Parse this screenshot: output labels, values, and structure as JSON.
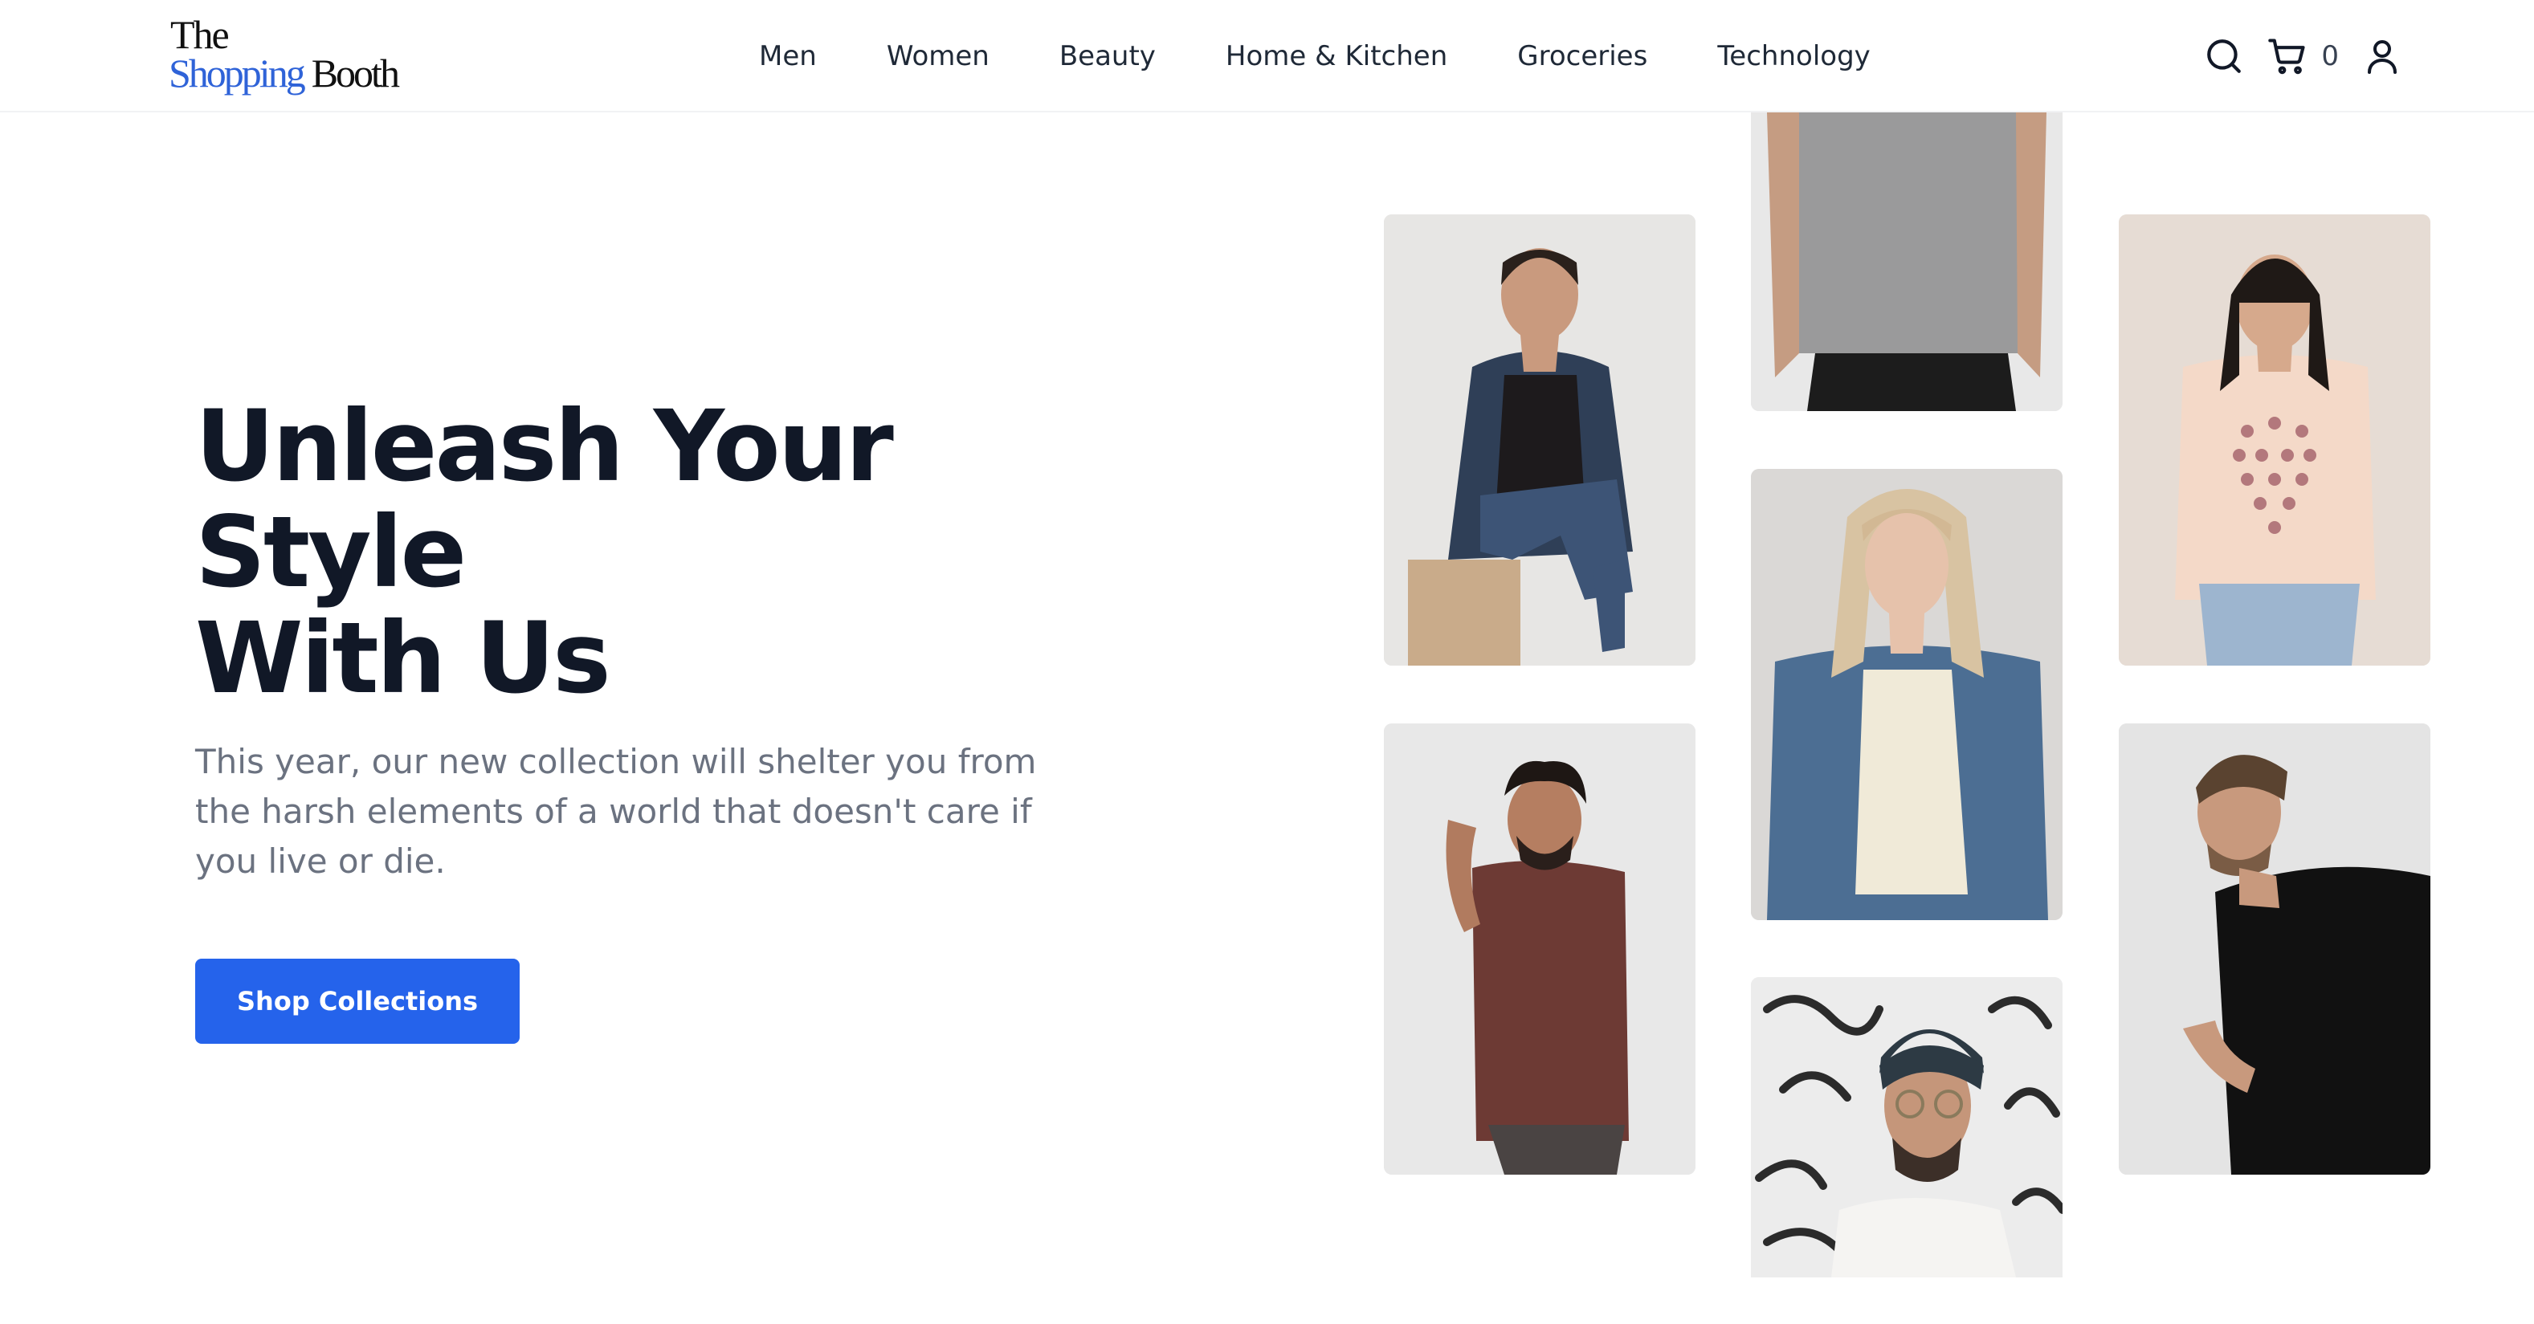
{
  "brand": {
    "line1": "The",
    "line2a": "Shopping",
    "line2b": "Booth",
    "accent_color": "#2f63d8"
  },
  "nav": {
    "items": [
      {
        "label": "Men"
      },
      {
        "label": "Women"
      },
      {
        "label": "Beauty"
      },
      {
        "label": "Home & Kitchen"
      },
      {
        "label": "Groceries"
      },
      {
        "label": "Technology"
      }
    ]
  },
  "actions": {
    "search_icon": "search-icon",
    "cart_icon": "cart-icon",
    "cart_count": "0",
    "user_icon": "user-icon"
  },
  "hero": {
    "title_line1": "Unleash Your Style",
    "title_line2": "With Us",
    "subtitle": "This year, our new collection will shelter you from the harsh elements of a world that doesn't care if you live or die.",
    "cta_label": "Shop Collections",
    "cta_color": "#2563eb"
  },
  "gallery": {
    "tiles": [
      {
        "name": "woman-denim-jacket-photo"
      },
      {
        "name": "man-curly-hair-photo"
      },
      {
        "name": "man-grey-tshirt-photo"
      },
      {
        "name": "woman-blonde-denim-photo"
      },
      {
        "name": "man-beanie-glasses-photo"
      },
      {
        "name": "woman-pink-tshirt-photo"
      },
      {
        "name": "man-black-tshirt-photo"
      }
    ]
  }
}
